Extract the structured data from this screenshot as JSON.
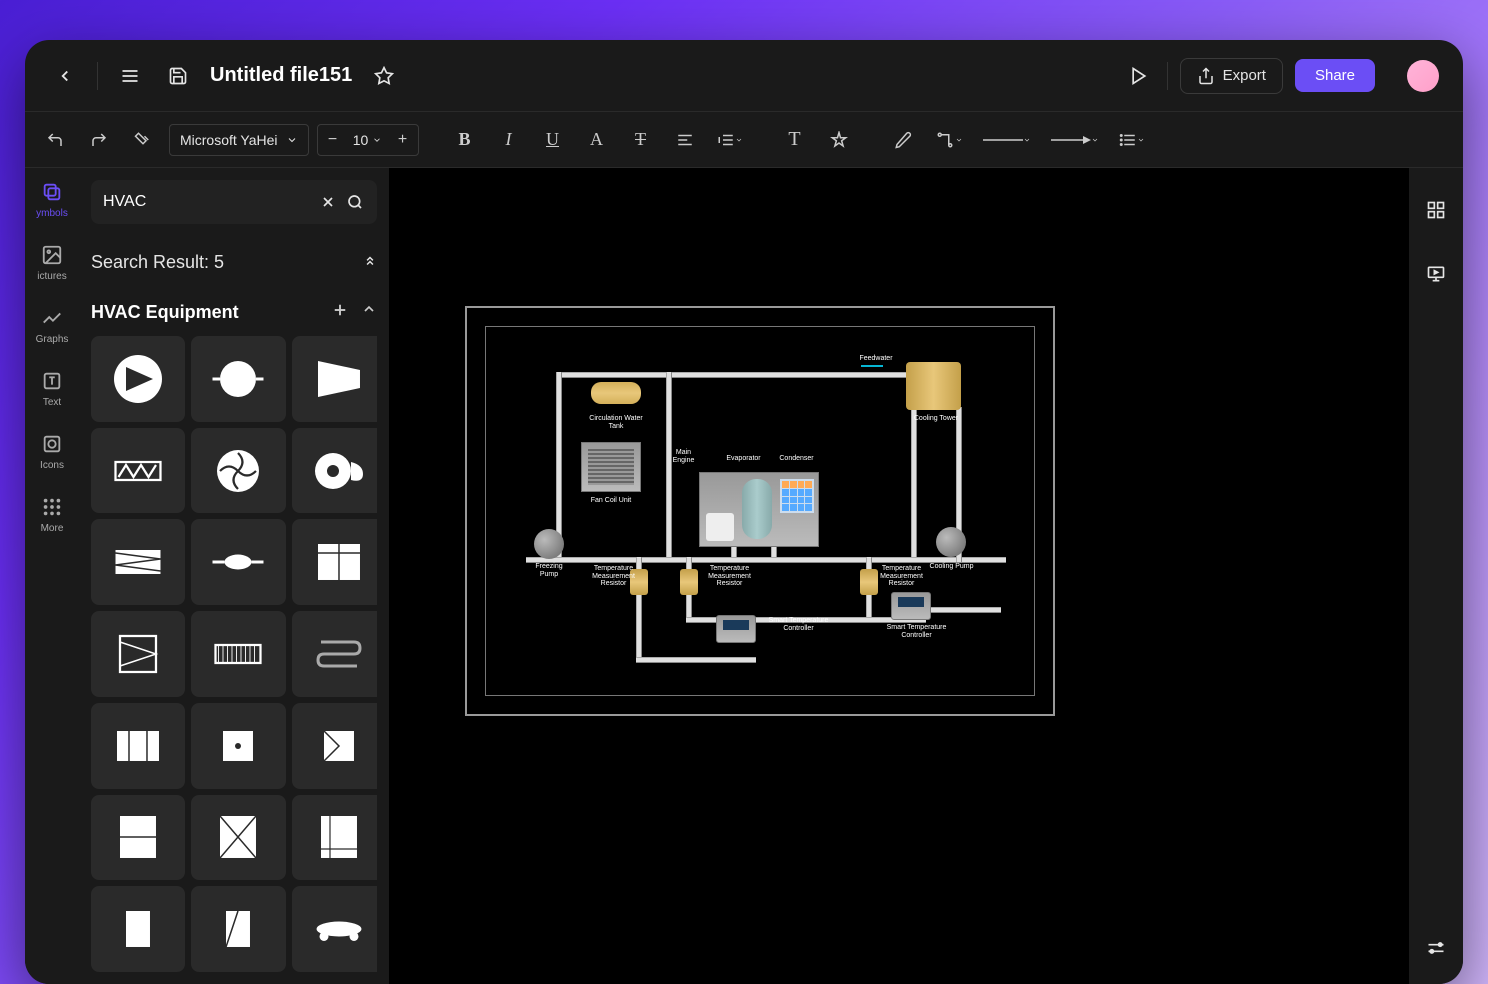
{
  "file_title": "Untitled file151",
  "toolbar": {
    "font_name": "Microsoft YaHei",
    "font_size": "10"
  },
  "titlebar": {
    "export_label": "Export",
    "share_label": "Share"
  },
  "left_rail": [
    {
      "id": "symbols",
      "label": "ymbols"
    },
    {
      "id": "pictures",
      "label": "ictures"
    },
    {
      "id": "graphs",
      "label": "Graphs"
    },
    {
      "id": "text",
      "label": "Text"
    },
    {
      "id": "icons",
      "label": "Icons"
    },
    {
      "id": "more",
      "label": "More"
    }
  ],
  "search": {
    "query": "HVAC",
    "result_label": "Search Result: 5"
  },
  "category": {
    "title": "HVAC Equipment"
  },
  "diagram_labels": {
    "feedwater": "Feedwater",
    "circulation_tank": "Circulation Water Tank",
    "cooling_tower": "Cooling Tower",
    "fan_coil": "Fan Coil Unit",
    "main_engine": "Main Engine",
    "evaporator": "Evaporator",
    "condenser": "Condenser",
    "freezing_pump": "Freezing Pump",
    "tmr1": "Temperature Measurement Resistor",
    "tmr2": "Temperature Measurement Resistor",
    "tmr3": "Temperature Measurement Resistor",
    "cooling_pump": "Cooling Pump",
    "stc1": "Smart Temperature Controller",
    "stc2": "Smart Temperature Controller"
  }
}
